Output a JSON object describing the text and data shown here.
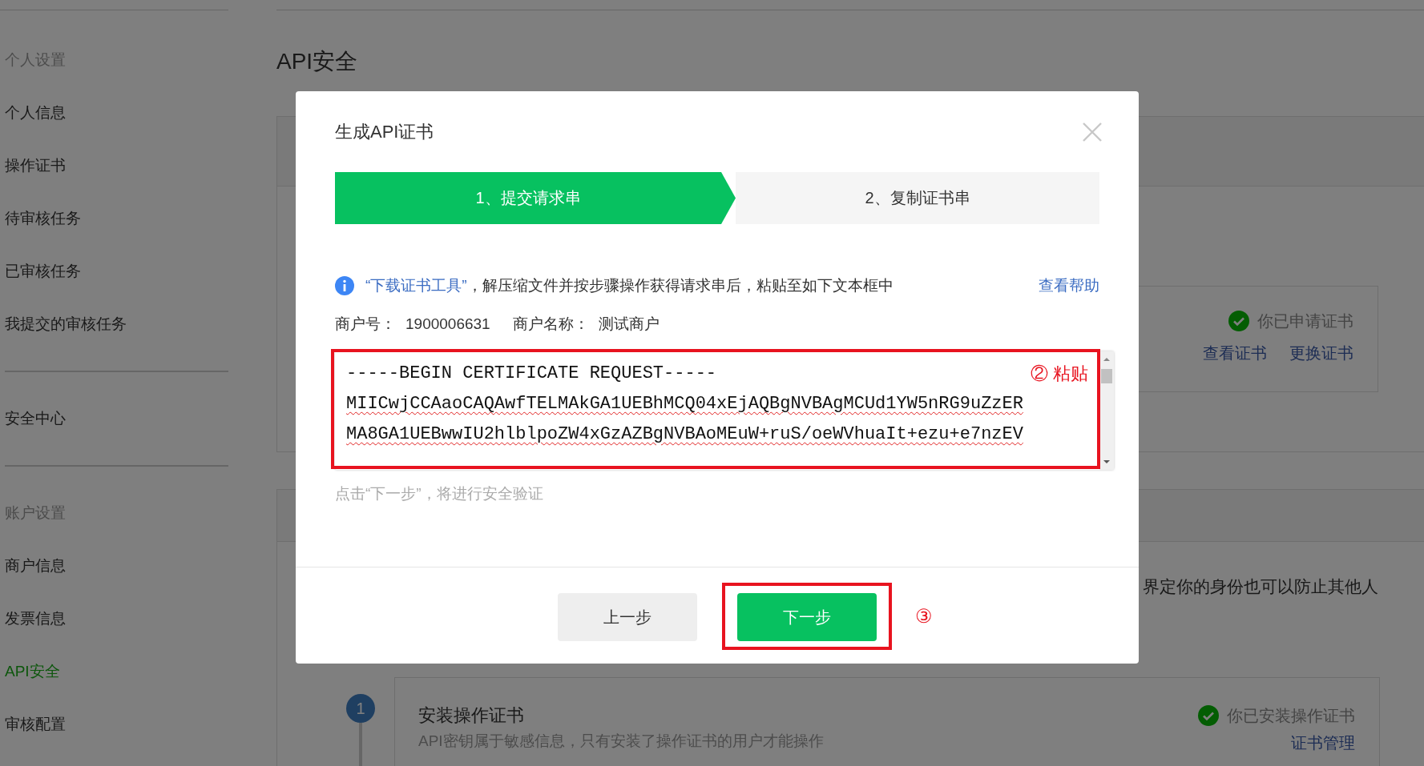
{
  "sidebar": {
    "groups": [
      {
        "heading": "个人设置",
        "items": [
          {
            "label": "个人信息",
            "selected": false
          },
          {
            "label": "操作证书",
            "selected": false
          },
          {
            "label": "待审核任务",
            "selected": false
          },
          {
            "label": "已审核任务",
            "selected": false
          },
          {
            "label": "我提交的审核任务",
            "selected": false
          }
        ]
      },
      {
        "items": [
          {
            "label": "安全中心",
            "selected": false
          }
        ]
      },
      {
        "heading": "账户设置",
        "items": [
          {
            "label": "商户信息",
            "selected": false
          },
          {
            "label": "发票信息",
            "selected": false
          },
          {
            "label": "API安全",
            "selected": true
          },
          {
            "label": "审核配置",
            "selected": false
          }
        ]
      }
    ]
  },
  "page": {
    "title": "API安全",
    "apply_status": {
      "status": "你已申请证书",
      "links": [
        "查看证书",
        "更换证书"
      ]
    },
    "description_fragment": "界定你的身份也可以防止其他人",
    "step_card": {
      "number": "1",
      "title": "安装操作证书",
      "description": "API密钥属于敏感信息，只有安装了操作证书的用户才能操作",
      "status": "你已安装操作证书",
      "link": "证书管理"
    }
  },
  "dialog": {
    "title": "生成API证书",
    "steps": [
      {
        "label": "1、提交请求串",
        "selected": true
      },
      {
        "label": "2、复制证书串",
        "selected": false
      }
    ],
    "notice": {
      "link": "“下载证书工具”",
      "text": "，解压缩文件并按步骤操作获得请求串后，粘贴至如下文本框中"
    },
    "help_link": "查看帮助",
    "merchant": [
      {
        "label": "商户号：",
        "value": "1900006631"
      },
      {
        "label": "商户名称：",
        "value": "测试商户"
      }
    ],
    "request_lines": [
      {
        "text": "-----BEGIN CERTIFICATE REQUEST-----",
        "spell_error": false
      },
      {
        "text": "MIICwjCCAaoCAQAwfTELMAkGA1UEBhMCQ04xEjAQBgNVBAgMCUd1YW5nRG9uZzER",
        "spell_error": true
      },
      {
        "text": "MA8GA1UEBwwIU2hlblpoZW4xGzAZBgNVBAoMEuW+ruS/oeWVhuaIt+ezu+e7nzEV",
        "spell_error": true
      }
    ],
    "hint": "点击“下一步”，将进行安全验证",
    "buttons": [
      {
        "label": "上一步",
        "kind": "secondary"
      },
      {
        "label": "下一步",
        "kind": "primary"
      }
    ]
  },
  "annotations": {
    "paste": "② 粘贴",
    "next": "③"
  }
}
